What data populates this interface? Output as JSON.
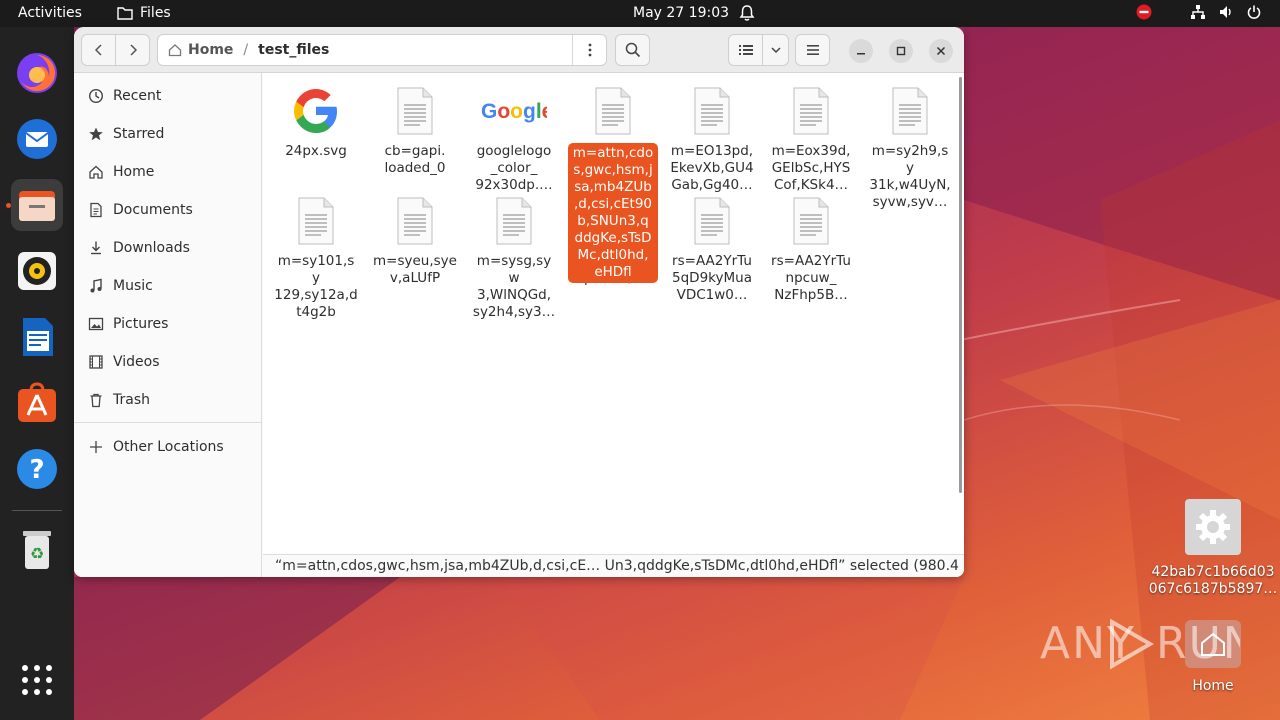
{
  "topbar": {
    "activities": "Activities",
    "app_name": "Files",
    "clock": "May 27  19:03"
  },
  "window": {
    "path": [
      "Home",
      "test_files"
    ]
  },
  "sidebar": {
    "items": [
      {
        "label": "Recent",
        "icon": "clock-icon"
      },
      {
        "label": "Starred",
        "icon": "star-icon"
      },
      {
        "label": "Home",
        "icon": "home-icon"
      },
      {
        "label": "Documents",
        "icon": "document-icon"
      },
      {
        "label": "Downloads",
        "icon": "download-icon"
      },
      {
        "label": "Music",
        "icon": "music-icon"
      },
      {
        "label": "Pictures",
        "icon": "picture-icon"
      },
      {
        "label": "Videos",
        "icon": "video-icon"
      },
      {
        "label": "Trash",
        "icon": "trash-icon"
      }
    ],
    "other_locations": "Other Locations"
  },
  "files": [
    {
      "name": "24px.svg",
      "icon": "google-g-icon"
    },
    {
      "name": "cb=gapi.\nloaded_0",
      "icon": "text-file-icon"
    },
    {
      "name": "googlelogo\n_color_\n92x30dp.…",
      "icon": "google-logo-icon"
    },
    {
      "name": "m=attn,cdo\ns,gwc,hsm,j\nsa,mb4ZUb\n,d,csi,cEt90\nb,SNUn3,q\nddgKe,sTsD\nMc,dtl0hd,\neHDfl",
      "icon": "text-file-icon",
      "selected": true
    },
    {
      "name": "m=EO13pd,\nEkevXb,GU4\nGab,Gg40…",
      "icon": "text-file-icon"
    },
    {
      "name": "m=Eox39d,\nGElbSc,HYS\nCof,KSk4…",
      "icon": "text-file-icon"
    },
    {
      "name": "m=sy2h9,sy\n31k,w4UyN,\nsyvw,syv…",
      "icon": "text-file-icon"
    },
    {
      "name": "m=sy101,sy\n129,sy12a,d\nt4g2b",
      "icon": "text-file-icon"
    },
    {
      "name": "m=syeu,sye\nv,aLUfP",
      "icon": "text-file-icon"
    },
    {
      "name": "m=sysg,syw\n3,WlNQGd,\nsy2h4,sy3…",
      "icon": "text-file-icon"
    },
    {
      "name": "y1o9,sy2gz,\nDpX64d,s…",
      "icon": "text-file-icon"
    },
    {
      "name": "rs=AA2YrTu\n5qD9kyMua\nVDC1w0…",
      "icon": "text-file-icon"
    },
    {
      "name": "rs=AA2YrTu\nnpcuw_\nNzFhp5B…",
      "icon": "text-file-icon"
    }
  ],
  "statusbar": {
    "text": "“m=attn,cdos,gwc,hsm,jsa,mb4ZUb,d,csi,cE…  Un3,qddgKe,sTsDMc,dtl0hd,eHDfl” selected  (980.4 kB)"
  },
  "desktop": {
    "file_label": "42bab7c1b66d03\n067c6187b5897…",
    "home_label": "Home"
  },
  "watermark": "ANY RUN",
  "colors": {
    "accent": "#e95420",
    "topbar": "#1b1b1b",
    "dock": "#222222"
  }
}
